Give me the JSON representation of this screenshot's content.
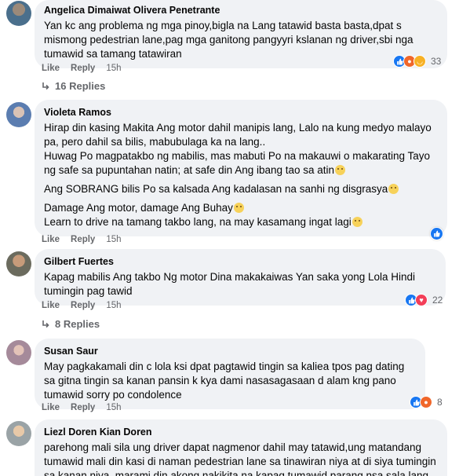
{
  "comments": [
    {
      "author": "Angelica Dimaiwat Olivera Penetrante",
      "lines": [
        "Yan kc ang problema ng mga pinoy,bigla na Lang tatawid basta basta,dpat s mismong pedestrian lane,pag mga ganitong pangyyri kslanan ng driver,sbi nga tumawid sa tamang tatawiran"
      ],
      "like_label": "Like",
      "reply_label": "Reply",
      "time": "15h",
      "reaction_count": "33",
      "reactions": [
        "like",
        "angry",
        "haha"
      ],
      "replies_label": "16 Replies"
    },
    {
      "author": "Violeta Ramos",
      "p1": "Hirap din kasing Makita Ang motor dahil manipis lang, Lalo na kung medyo malayo pa, pero dahil sa bilis, mabubulaga ka na lang..",
      "p2": "Huwag Po magpatakbo ng mabilis, mas mabuti Po na makauwi o makarating Tayo ng safe sa pupuntahan natin; at safe din Ang ibang tao sa atin",
      "p3": "Ang SOBRANG bilis Po sa kalsada Ang kadalasan na sanhi ng disgrasya",
      "p4": "Damage Ang motor, damage Ang Buhay",
      "p5": "Learn to drive na tamang takbo lang, na may kasamang ingat lagi",
      "like_label": "Like",
      "reply_label": "Reply",
      "time": "15h",
      "reactions": [
        "like"
      ]
    },
    {
      "author": "Gilbert Fuertes",
      "text": "Kapag mabilis Ang takbo Ng motor Dina makakaiwas Yan saka yong Lola Hindi tumingin pag tawid",
      "like_label": "Like",
      "reply_label": "Reply",
      "time": "15h",
      "reaction_count": "22",
      "reactions": [
        "like",
        "love"
      ],
      "replies_label": "8 Replies"
    },
    {
      "author": "Susan Saur",
      "text": "May pagkakamali din c lola ksi dpat pagtawid tingin sa kaliea tpos pag dating sa gitna tingin sa kanan pansin k kya dami nasasagasaan d alam kng pano tumawid sorry po condolence",
      "like_label": "Like",
      "reply_label": "Reply",
      "time": "15h",
      "reaction_count": "8",
      "reactions": [
        "like",
        "angry"
      ]
    },
    {
      "author": "Liezl Doren Kian Doren",
      "text": "parehong mali sila ung driver dapat nagmenor dahil may tatawid,ung matandang tumawid mali din kasi di naman pedestrian lane sa tinawiran niya at di siya tumingin sa kanan niya, marami din akong nakikita na kapag tumawid parang nsa sala lang"
    }
  ],
  "colors": {
    "bubble": "#f0f2f5",
    "meta": "#65676b",
    "like_blue": "#1877f2",
    "angry_orange": "#f0672b",
    "love_red": "#f33e58"
  },
  "icons": [
    "like-reaction-icon",
    "angry-reaction-icon",
    "haha-reaction-icon",
    "love-reaction-icon",
    "reply-arrow-icon",
    "smile-emoji-icon"
  ]
}
